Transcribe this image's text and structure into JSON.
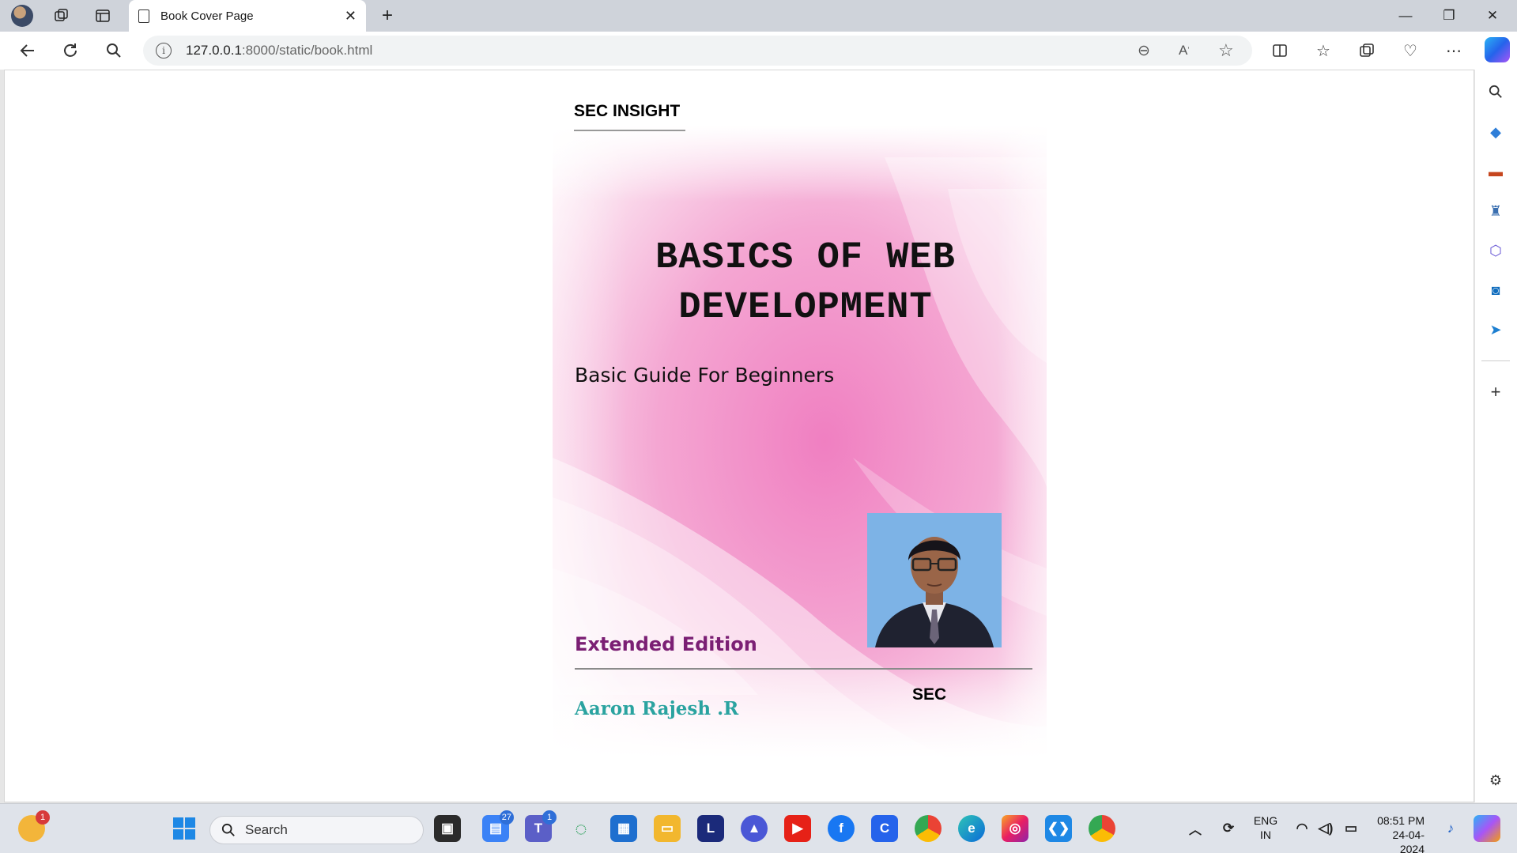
{
  "browser": {
    "tab_title": "Book Cover Page",
    "url_host": "127.0.0.1",
    "url_path": ":8000/static/book.html",
    "window_controls": [
      "minimize",
      "restore",
      "close"
    ]
  },
  "page": {
    "brand": "SEC INSIGHT",
    "book_title": "BASICS OF WEB DEVELOPMENT",
    "subtitle": "Basic Guide For Beginners",
    "edition": "Extended Edition",
    "author": "Aaron Rajesh .R",
    "publisher": "SEC",
    "colors": {
      "cover_pink": "#f07fc1",
      "edition": "#7b1f74",
      "author": "#2aa3a0"
    }
  },
  "sidebar": {
    "icons": [
      "search-icon",
      "tag-icon",
      "toolbox-icon",
      "chess-icon",
      "copilot-icon",
      "outlook-icon",
      "send-icon",
      "add-icon",
      "settings-icon"
    ]
  },
  "taskbar": {
    "search_label": "Search",
    "weather_badge": "1",
    "widgets_badge": "27",
    "teams_badge": "1",
    "lang_line1": "ENG",
    "lang_line2": "IN",
    "time": "08:51 PM",
    "date": "24-04-2024"
  }
}
